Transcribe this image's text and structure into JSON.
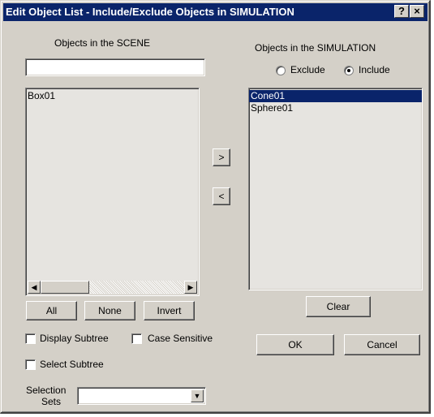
{
  "window": {
    "title": "Edit Object List - Include/Exclude Objects in SIMULATION",
    "help_button": "?",
    "close_button": "×"
  },
  "scene": {
    "heading": "Objects in the SCENE",
    "filter_value": "",
    "items": [
      "Box01"
    ],
    "buttons": {
      "all": "All",
      "none": "None",
      "invert": "Invert"
    }
  },
  "transfer": {
    "add": ">",
    "remove": "<"
  },
  "simulation": {
    "heading": "Objects in the SIMULATION",
    "exclude_label": "Exclude",
    "include_label": "Include",
    "mode": "Include",
    "items": [
      "Cone01",
      "Sphere01"
    ],
    "selected_item": "Cone01",
    "clear": "Clear"
  },
  "options": {
    "display_subtree": "Display Subtree",
    "case_sensitive": "Case Sensitive",
    "select_subtree": "Select Subtree",
    "display_subtree_checked": false,
    "case_sensitive_checked": false,
    "select_subtree_checked": false
  },
  "selection_sets": {
    "label_line1": "Selection",
    "label_line2": "Sets",
    "value": ""
  },
  "footer": {
    "ok": "OK",
    "cancel": "Cancel"
  },
  "colors": {
    "titlebar": "#0a246a",
    "dialog": "#d4d0c8",
    "selection": "#0a246a"
  }
}
